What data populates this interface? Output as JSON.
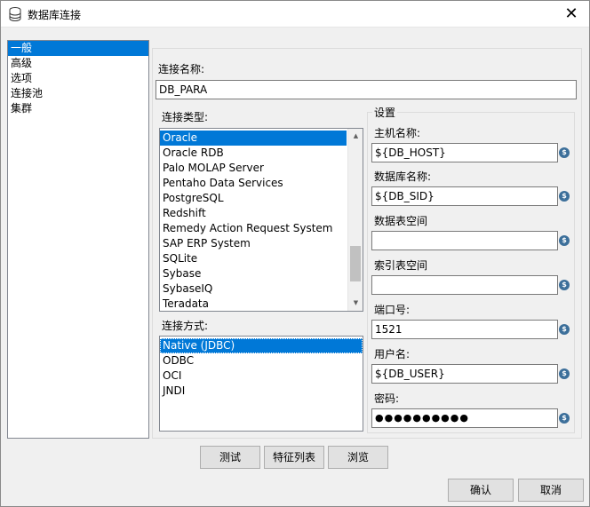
{
  "window": {
    "title": "数据库连接",
    "close": "✕",
    "db_icon": "database-icon"
  },
  "nav": {
    "items": [
      {
        "label": "一般",
        "selected": true
      },
      {
        "label": "高级",
        "selected": false
      },
      {
        "label": "选项",
        "selected": false
      },
      {
        "label": "连接池",
        "selected": false
      },
      {
        "label": "集群",
        "selected": false
      }
    ]
  },
  "connection_name": {
    "label": "连接名称:",
    "value": "DB_PARA"
  },
  "connection_type": {
    "label": "连接类型:",
    "items": [
      "Oracle",
      "Oracle RDB",
      "Palo MOLAP Server",
      "Pentaho Data Services",
      "PostgreSQL",
      "Redshift",
      "Remedy Action Request System",
      "SAP ERP System",
      "SQLite",
      "Sybase",
      "SybaseIQ",
      "Teradata"
    ],
    "selected": "Oracle"
  },
  "access_method": {
    "label": "连接方式:",
    "items": [
      "Native (JDBC)",
      "ODBC",
      "OCI",
      "JNDI"
    ],
    "selected": "Native (JDBC)"
  },
  "settings": {
    "title": "设置",
    "host": {
      "label": "主机名称:",
      "value": "${DB_HOST}"
    },
    "db_name": {
      "label": "数据库名称:",
      "value": "${DB_SID}"
    },
    "tablespace": {
      "label": "数据表空间",
      "value": ""
    },
    "index_tablespace": {
      "label": "索引表空间",
      "value": ""
    },
    "port": {
      "label": "端口号:",
      "value": "1521"
    },
    "user": {
      "label": "用户名:",
      "value": "${DB_USER}"
    },
    "password": {
      "label": "密码:",
      "value": "●●●●●●●●●●"
    },
    "variable_icon": "$"
  },
  "buttons": {
    "test": "测试",
    "features": "特征列表",
    "explore": "浏览",
    "ok": "确认",
    "cancel": "取消"
  }
}
